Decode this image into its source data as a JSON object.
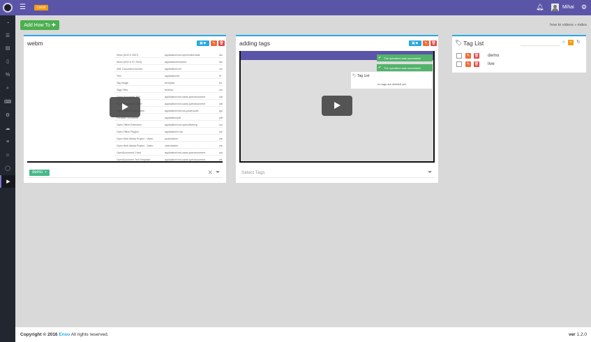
{
  "topbar": {
    "env_badge": "Local",
    "user_name": "Mihai",
    "menu_icon": "hamburger-icon",
    "notifications_icon": "bell-icon",
    "settings_icon": "gear-icon"
  },
  "sidebar": {
    "items": [
      "dashboard-icon",
      "list-icon",
      "table-icon",
      "document-icon",
      "percent-icon",
      "search-icon",
      "keyboard-icon",
      "gears-icon",
      "cloud-icon",
      "sliders-icon",
      "users-icon",
      "chat-icon",
      "video-icon"
    ],
    "active_index": 12
  },
  "toolbar": {
    "add_button": "Add How To"
  },
  "breadcrumbs": {
    "section": "how to videos",
    "sep": "»",
    "page": "index"
  },
  "videos": [
    {
      "title": "webm",
      "tags": [
        "demo"
      ],
      "tag_remove": "×",
      "clear": "✕"
    },
    {
      "title": "adding tags",
      "tags": [],
      "select_placeholder": "Select Tags",
      "inner_toasts": [
        "The operation was successful",
        "The operation was successful"
      ],
      "inner_card_title": "Tag List",
      "inner_card_message": "no tags are defined yet"
    }
  ],
  "screenshot_rows": [
    {
      "name": "Word (DOCX 2007)",
      "mime": "application/vnd.openxmlformats",
      "ext": "docx"
    },
    {
      "name": "Word (DOCX 97 2003)",
      "mime": "application/msword",
      "ext": "doc"
    },
    {
      "name": "XML Document Archive",
      "mime": "application/xml",
      "ext": "xml"
    },
    {
      "name": "Text",
      "mime": "application/rtf",
      "ext": "rtf"
    },
    {
      "name": "Tag Image",
      "mime": "text/plain",
      "ext": "txt"
    },
    {
      "name": "Tags Files",
      "mime": "text/csv",
      "ext": "csv"
    },
    {
      "name": "Open Document Text",
      "mime": "application/vnd.oasis.opendocument",
      "ext": "odt"
    },
    {
      "name": "Open Document Sheet",
      "mime": "application/vnd.oasis.opendocument",
      "ext": "ods"
    },
    {
      "name": "Open Office Presentation",
      "mime": "application/vnd.ms-powerpoint",
      "ext": "ppt"
    },
    {
      "name": "Portable Document",
      "mime": "application/pdf",
      "ext": "pdf"
    },
    {
      "name": "Open Office Extension",
      "mime": "application/vnd.openofficeorg",
      "ext": "oxt"
    },
    {
      "name": "Open Office Plugins",
      "mime": "application/x-zip",
      "ext": "zip"
    },
    {
      "name": "Open Web Media Project - Video",
      "mime": "audio/webm",
      "ext": "webm"
    },
    {
      "name": "Open Web Media Project - Video",
      "mime": "video/webm",
      "ext": "webm"
    },
    {
      "name": "OpenDocument Chart",
      "mime": "application/vnd.oasis.opendocument",
      "ext": "odc"
    },
    {
      "name": "OpenDocument Text Template",
      "mime": "application/vnd.oasis.opendocument",
      "ext": "ott"
    }
  ],
  "tag_list": {
    "title": "Tag List",
    "tags": [
      "demo",
      "live"
    ]
  },
  "footer": {
    "copyright": "Copyright © 2016",
    "brand": "Enso",
    "rights": "All rights reserved.",
    "version_label": "ver",
    "version": "1.2.0"
  },
  "colors": {
    "topbar": "#5b55a8",
    "sidebar": "#22262e",
    "accent": "#29a9e0",
    "success": "#4caf50",
    "tag_chip": "#47b88a",
    "edit": "#f26b3a",
    "delete": "#e04b4b"
  }
}
